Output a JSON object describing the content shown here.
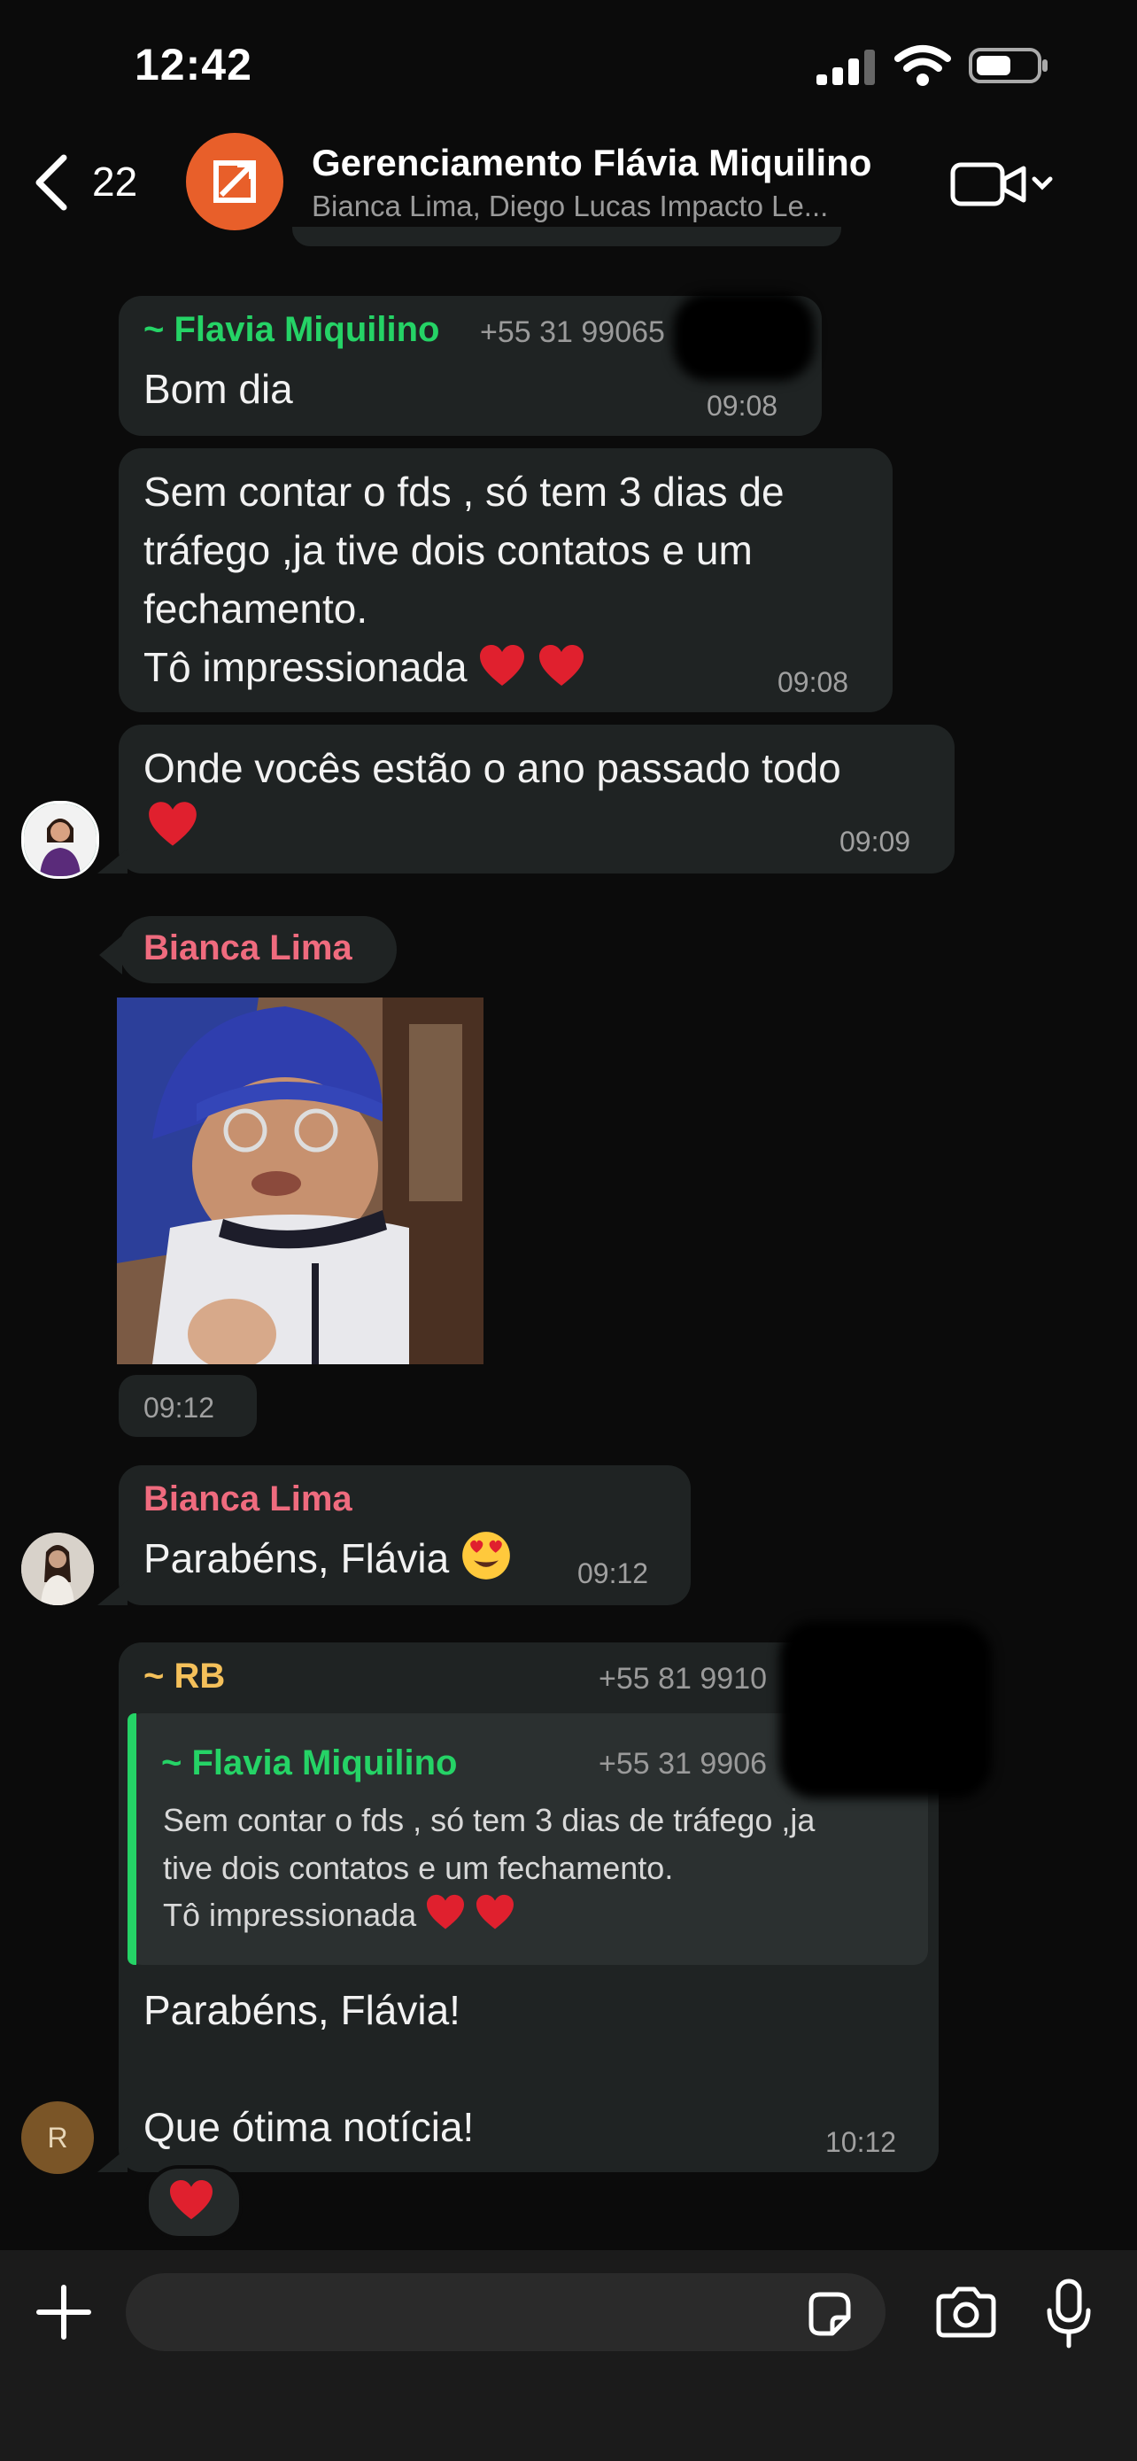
{
  "status_bar": {
    "time": "12:42"
  },
  "header": {
    "back_count": "22",
    "title": "Gerenciamento Flávia Miquilino",
    "subtitle": "Bianca Lima, Diego Lucas Impacto Le..."
  },
  "messages": [
    {
      "sender": "~ Flavia Miquilino",
      "phone": "+55 31 99065",
      "text": "Bom dia",
      "time": "09:08"
    },
    {
      "lines": [
        "Sem contar o fds , só tem 3 dias de",
        "tráfego ,ja tive dois contatos e um",
        "fechamento.",
        "Tô impressionada"
      ],
      "time": "09:08"
    },
    {
      "lines": [
        "Onde vocês estão o ano passado todo"
      ],
      "time": "09:09"
    },
    {
      "sender": "Bianca Lima",
      "media": "photo",
      "time": "09:12"
    },
    {
      "sender": "Bianca Lima",
      "text": "Parabéns, Flávia",
      "time": "09:12"
    },
    {
      "sender": "~ RB",
      "phone": "+55 81 9910",
      "quote": {
        "sender": "~ Flavia Miquilino",
        "phone": "+55 31 9906",
        "lines": [
          "Sem contar o fds , só tem 3 dias de tráfego ,ja",
          "tive dois contatos e um fechamento.",
          "Tô impressionada"
        ]
      },
      "lines": [
        "Parabéns, Flávia!",
        "Que ótima notícia!"
      ],
      "time": "10:12",
      "avatar_initial": "R",
      "reaction": "heart"
    }
  ],
  "colors": {
    "flavia": "#25d366",
    "bianca": "#ef6b7e",
    "rb": "#f4c05a",
    "bubble": "#1f2323",
    "background": "#0b0b0b"
  }
}
